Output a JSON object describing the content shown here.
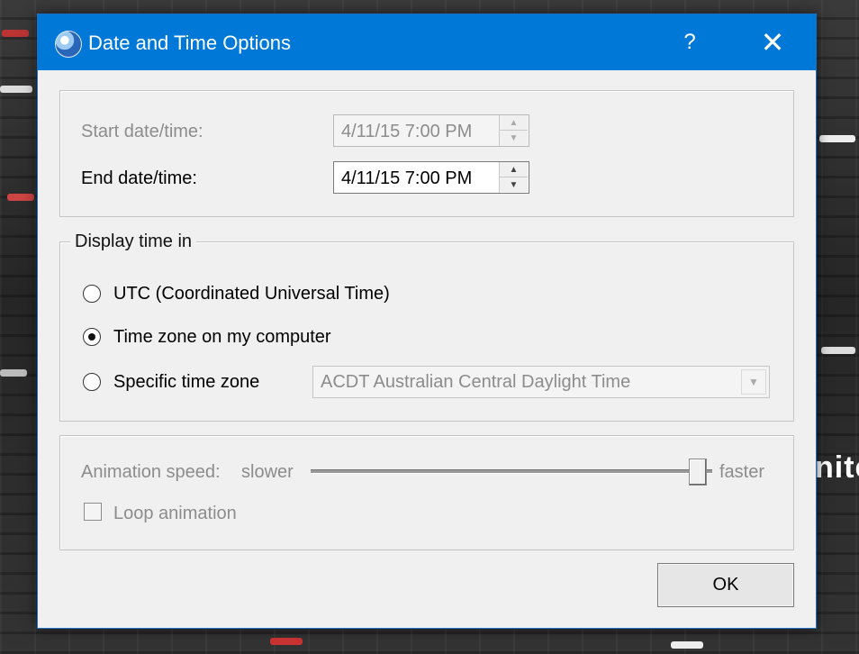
{
  "window": {
    "title": "Date and Time Options",
    "help_label": "?",
    "close_label": "✕",
    "title_bar_color": "#0078d7",
    "icon": "google-earth-icon"
  },
  "date_range": {
    "start_label": "Start date/time:",
    "start_value": "4/11/15 7:00 PM",
    "start_enabled": false,
    "end_label": "End date/time:",
    "end_value": "4/11/15 7:00 PM",
    "end_enabled": true,
    "spin_up": "▲",
    "spin_down": "▼"
  },
  "display_time": {
    "legend": "Display time in",
    "options": [
      {
        "label": "UTC (Coordinated Universal Time)",
        "checked": false
      },
      {
        "label": "Time zone on my computer",
        "checked": true
      },
      {
        "label": "Specific time zone",
        "checked": false
      }
    ],
    "timezone_value": "ACDT Australian Central Daylight Time",
    "timezone_enabled": false,
    "dropdown_arrow": "▼"
  },
  "animation": {
    "speed_label": "Animation speed:",
    "slower_label": "slower",
    "faster_label": "faster",
    "speed_level": 0.97,
    "loop_label": "Loop animation",
    "loop_checked": false,
    "enabled": false
  },
  "ok_label": "OK",
  "background": {
    "partial_text": "nite"
  }
}
